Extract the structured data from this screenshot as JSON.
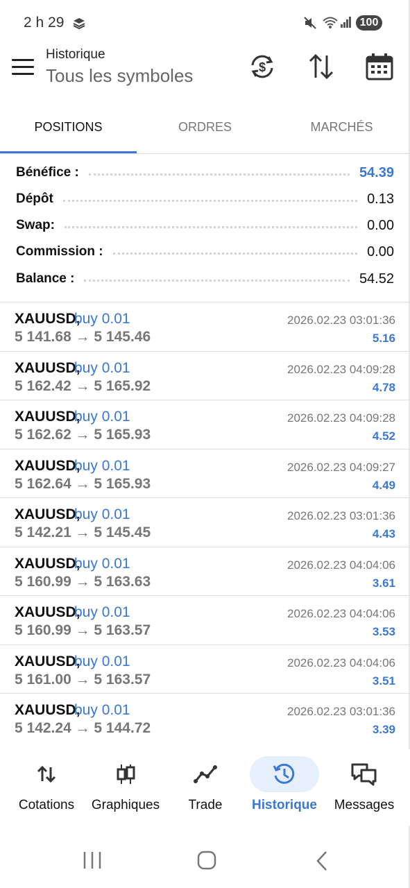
{
  "status_bar": {
    "time": "2 h 29",
    "battery": "100",
    "icons": [
      "stack-notification-icon",
      "mute-icon",
      "wifi-icon",
      "signal-icon",
      "battery-icon"
    ]
  },
  "header": {
    "title": "Historique",
    "subtitle": "Tous les symboles",
    "icons": [
      "menu-icon",
      "currency-sync-icon",
      "sort-icon",
      "calendar-icon"
    ]
  },
  "tabs": [
    {
      "label": "POSITIONS",
      "active": true
    },
    {
      "label": "ORDRES",
      "active": false
    },
    {
      "label": "MARCHÉS",
      "active": false
    }
  ],
  "summary": [
    {
      "label": "Bénéfice :",
      "value": "54.39",
      "highlight": true
    },
    {
      "label": "Dépôt",
      "value": "0.13",
      "highlight": false
    },
    {
      "label": "Swap:",
      "value": "0.00",
      "highlight": false
    },
    {
      "label": "Commission :",
      "value": "0.00",
      "highlight": false
    },
    {
      "label": "Balance :",
      "value": "54.52",
      "highlight": false
    }
  ],
  "deals": [
    {
      "symbol": "XAUUSD,",
      "side": "buy 0.01",
      "prices": "5 141.68 → 5 145.46",
      "time": "2026.02.23 03:01:36",
      "profit": "5.16"
    },
    {
      "symbol": "XAUUSD,",
      "side": "buy 0.01",
      "prices": "5 162.42 → 5 165.92",
      "time": "2026.02.23 04:09:28",
      "profit": "4.78"
    },
    {
      "symbol": "XAUUSD,",
      "side": "buy 0.01",
      "prices": "5 162.62 → 5 165.93",
      "time": "2026.02.23 04:09:28",
      "profit": "4.52"
    },
    {
      "symbol": "XAUUSD,",
      "side": "buy 0.01",
      "prices": "5 162.64 → 5 165.93",
      "time": "2026.02.23 04:09:27",
      "profit": "4.49"
    },
    {
      "symbol": "XAUUSD,",
      "side": "buy 0.01",
      "prices": "5 142.21 → 5 145.45",
      "time": "2026.02.23 03:01:36",
      "profit": "4.43"
    },
    {
      "symbol": "XAUUSD,",
      "side": "buy 0.01",
      "prices": "5 160.99 → 5 163.63",
      "time": "2026.02.23 04:04:06",
      "profit": "3.61"
    },
    {
      "symbol": "XAUUSD,",
      "side": "buy 0.01",
      "prices": "5 160.99 → 5 163.57",
      "time": "2026.02.23 04:04:06",
      "profit": "3.53"
    },
    {
      "symbol": "XAUUSD,",
      "side": "buy 0.01",
      "prices": "5 161.00 → 5 163.57",
      "time": "2026.02.23 04:04:06",
      "profit": "3.51"
    },
    {
      "symbol": "XAUUSD,",
      "side": "buy 0.01",
      "prices": "5 142.24 → 5 144.72",
      "time": "2026.02.23 03:01:36",
      "profit": "3.39"
    }
  ],
  "bottom_nav": [
    {
      "label": "Cotations",
      "icon": "quotes-arrows-icon",
      "active": false
    },
    {
      "label": "Graphiques",
      "icon": "candlestick-chart-icon",
      "active": false
    },
    {
      "label": "Trade",
      "icon": "trade-line-icon",
      "active": false
    },
    {
      "label": "Historique",
      "icon": "history-clock-icon",
      "active": true
    },
    {
      "label": "Messages",
      "icon": "messages-icon",
      "active": false
    }
  ],
  "colors": {
    "accent": "#3a78d2",
    "text": "#111111",
    "muted": "#777777",
    "active_nav_bg": "#e6f0fc"
  }
}
